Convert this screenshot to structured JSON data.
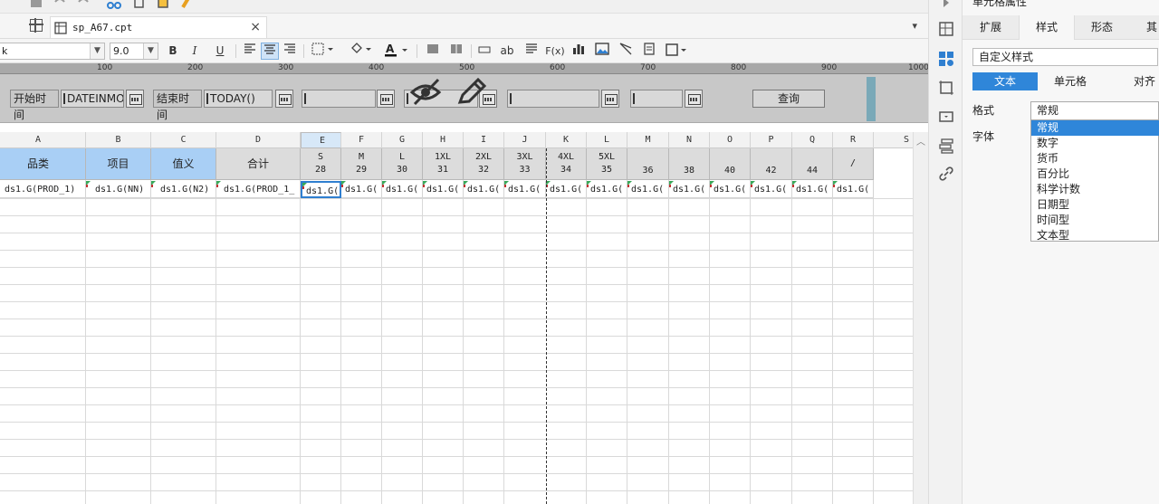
{
  "tabbar": {
    "file_name": "sp_A67.cpt",
    "close": "×"
  },
  "format_toolbar": {
    "font_name": "k",
    "font_size": "9.0",
    "bold": "B",
    "italic": "I",
    "underline": "U",
    "text_ab": "ab",
    "formula": "F(x)"
  },
  "ruler": {
    "ticks": [
      "100",
      "200",
      "300",
      "400",
      "500",
      "600",
      "700",
      "800",
      "900",
      "1000"
    ]
  },
  "params": {
    "start_label": "开始时间",
    "start_value": "DATEINMO",
    "end_label": "结束时间",
    "end_value": "TODAY()",
    "query_button": "查询"
  },
  "columns": [
    "A",
    "B",
    "C",
    "D",
    "E",
    "F",
    "G",
    "H",
    "I",
    "J",
    "K",
    "L",
    "M",
    "N",
    "O",
    "P",
    "Q",
    "R",
    "S"
  ],
  "header_row": [
    {
      "l1": "品类",
      "l2": ""
    },
    {
      "l1": "项目",
      "l2": ""
    },
    {
      "l1": "值义",
      "l2": ""
    },
    {
      "l1": "合计",
      "l2": ""
    },
    {
      "l1": "S",
      "l2": "28"
    },
    {
      "l1": "M",
      "l2": "29"
    },
    {
      "l1": "L",
      "l2": "30"
    },
    {
      "l1": "1XL",
      "l2": "31"
    },
    {
      "l1": "2XL",
      "l2": "32"
    },
    {
      "l1": "3XL",
      "l2": "33"
    },
    {
      "l1": "4XL",
      "l2": "34"
    },
    {
      "l1": "5XL",
      "l2": "35"
    },
    {
      "l1": "",
      "l2": "36"
    },
    {
      "l1": "",
      "l2": "38"
    },
    {
      "l1": "",
      "l2": "40"
    },
    {
      "l1": "",
      "l2": "42"
    },
    {
      "l1": "",
      "l2": "44"
    },
    {
      "l1": "/",
      "l2": ""
    }
  ],
  "data_row": [
    "ds1.G(PROD_1)",
    "ds1.G(NN)",
    "ds1.G(N2)",
    "ds1.G(PROD_1_",
    "ds1.G(",
    "ds1.G(",
    "ds1.G(",
    "ds1.G(",
    "ds1.G(",
    "ds1.G(",
    "ds1.G(",
    "ds1.G(",
    "ds1.G(",
    "ds1.G(",
    "ds1.G(",
    "ds1.G(",
    "ds1.G(",
    "ds1.G("
  ],
  "panel": {
    "title": "单元格属性",
    "tabs": [
      "扩展",
      "样式",
      "形态",
      "其"
    ],
    "style_value": "自定义样式",
    "subtabs": [
      "文本",
      "单元格",
      "对齐"
    ],
    "format_label": "格式",
    "font_label": "字体",
    "format_current": "常规",
    "format_options": [
      "常规",
      "数字",
      "货币",
      "百分比",
      "科学计数",
      "日期型",
      "时间型",
      "文本型"
    ]
  },
  "colors": {
    "accent": "#2f86d9",
    "header_blue": "#a9cff5",
    "param_bg": "#c8c8c8"
  }
}
